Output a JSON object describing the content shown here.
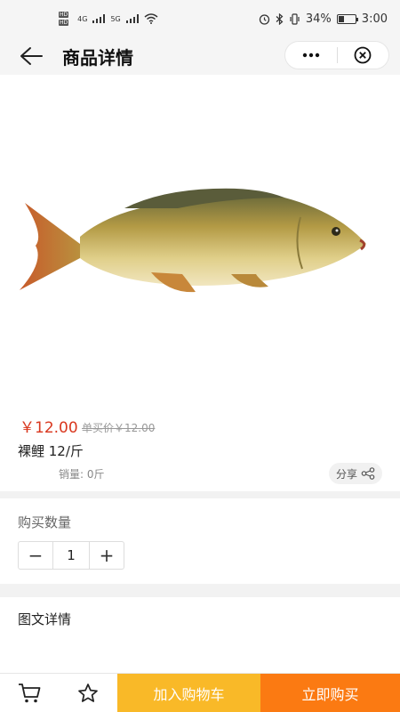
{
  "status_bar": {
    "network_left": "4G",
    "network_right": "5G",
    "hd1": "HD",
    "hd2": "HD",
    "battery_text": "34%",
    "battery_level": 0.34,
    "time": "3:00"
  },
  "nav": {
    "title": "商品详情",
    "back_icon": "arrow-left-icon",
    "more_icon": "more-dots-icon",
    "close_icon": "close-circle-icon"
  },
  "product": {
    "image": "carp-fish-photo",
    "price": "￥12.00",
    "original_price": "单买价￥12.00",
    "name": "裸鲤 12/斤",
    "sales": "销量: 0斤",
    "share_label": "分享"
  },
  "quantity": {
    "label": "购买数量",
    "value": "1",
    "minus": "−",
    "plus": "+"
  },
  "details": {
    "title": "图文详情"
  },
  "bottom_bar": {
    "cart_icon": "cart-icon",
    "favorite_icon": "star-icon",
    "add_to_cart": "加入购物车",
    "buy_now": "立即购买"
  },
  "colors": {
    "price_red": "#d9371e",
    "add_cart_yellow": "#f9b928",
    "buy_now_orange": "#fb7a12"
  }
}
